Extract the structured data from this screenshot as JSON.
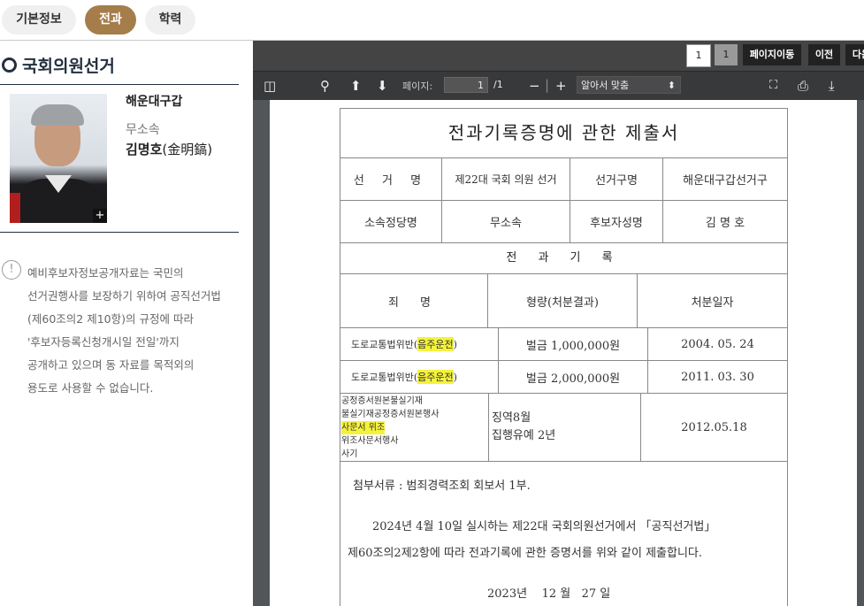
{
  "tabs": [
    {
      "label": "기본정보",
      "active": false
    },
    {
      "label": "전과",
      "active": true
    },
    {
      "label": "학력",
      "active": false
    }
  ],
  "section": {
    "title": "국회의원선거"
  },
  "candidate": {
    "district": "해운대구갑",
    "party": "무소속",
    "name": "김명호",
    "name_hanja": "(金明鎬)",
    "photo_expand": "+"
  },
  "notice": {
    "icon": "!",
    "lines": [
      "예비후보자정보공개자료는 국민의",
      "선거권행사를 보장하기 위하여 공직선거법",
      "(제60조의2 제10항)의 규정에 따라",
      "'후보자등록신청개시일 전일'까지",
      "공개하고 있으며 동 자료를 목적외의",
      "용도로 사용할 수 없습니다."
    ]
  },
  "pager": {
    "page_num": "1",
    "total": "1",
    "goto": "페이지이동",
    "prev": "이전",
    "next": "다음"
  },
  "toolbar": {
    "page_label": "페이지:",
    "page_value": "1",
    "page_total": "/1",
    "zoom": "알아서 맞춤",
    "icons": [
      "sidebar-toggle-icon",
      "search-icon",
      "prev-page-icon",
      "next-page-icon",
      "zoom-out-icon",
      "zoom-in-icon",
      "fullscreen-icon",
      "print-icon",
      "download-icon"
    ]
  },
  "document": {
    "title": "전과기록증명에 관한 제출서",
    "row1": [
      "선 거 명",
      "제22대 국회 의원 선거",
      "선거구명",
      "해운대구갑선거구"
    ],
    "row2": [
      "소속정당명",
      "무소속",
      "후보자성명",
      "김 명 호"
    ],
    "records_heading": "전 과 기 록",
    "headers": [
      "죄 명",
      "형량(처분결과)",
      "처분일자"
    ],
    "records": [
      {
        "crime_prefix": "도로교통법위반(",
        "crime_hl": "음주운전",
        "crime_suffix": ")",
        "penalty": "벌금 1,000,000원",
        "date": "2004. 05. 24"
      },
      {
        "crime_prefix": "도로교통법위반(",
        "crime_hl": "음주운전",
        "crime_suffix": ")",
        "penalty": "벌금 2,000,000원",
        "date": "2011. 03. 30"
      }
    ],
    "record3": {
      "crime_lines": [
        "공정증서원본불실기재",
        "불실기재공정증서원본행사"
      ],
      "crime_hl": "사문서 위조",
      "crime_rest": [
        "위조사문서행사",
        "사기"
      ],
      "penalty_lines": [
        "징역8월",
        "집행유예 2년"
      ],
      "date": "2012.05.18"
    },
    "attachment": "첨부서류 : 범죄경력조회 회보서 1부.",
    "statement_line1": "2024년 4월 10일 실시하는 제22대 국회의원선거에서 「공직선거법」",
    "statement_line2": "제60조의2제2항에 따라 전과기록에 관한 증명서를 위와 같이 제출합니다.",
    "date_line": "2023년    12 월   27 일"
  },
  "colors": {
    "active_tab": "#a57d4b",
    "title": "#233040",
    "highlight": "#f5f23b",
    "viewer_bg": "#525659"
  }
}
